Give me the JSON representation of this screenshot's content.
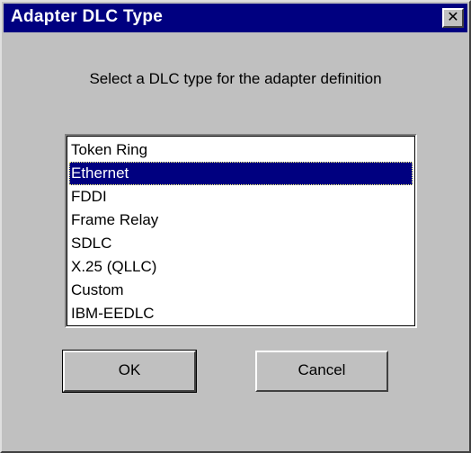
{
  "window": {
    "title": "Adapter DLC Type",
    "close_glyph": "✕",
    "close_icon": "close-icon"
  },
  "prompt": "Select a DLC type for the adapter definition",
  "dlc_list": {
    "items": [
      "Token Ring",
      "Ethernet",
      "FDDI",
      "Frame Relay",
      "SDLC",
      "X.25 (QLLC)",
      "Custom",
      "IBM-EEDLC"
    ],
    "selected": "Ethernet"
  },
  "buttons": {
    "ok_label": "OK",
    "cancel_label": "Cancel"
  },
  "colors": {
    "title_bar": "#000080",
    "dialog_bg": "#c0c0c0",
    "selection": "#000080"
  }
}
